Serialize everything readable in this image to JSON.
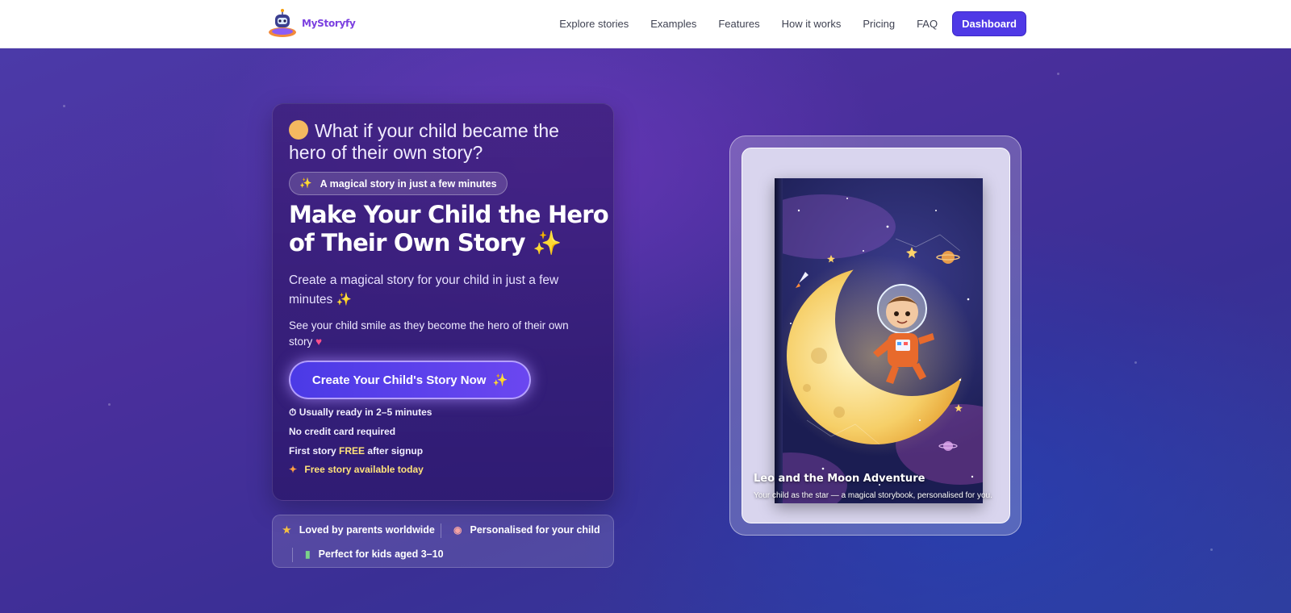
{
  "brand": {
    "name": "MyStoryfy"
  },
  "nav": {
    "links": [
      "Explore stories",
      "Examples",
      "Features",
      "How it works",
      "Pricing",
      "FAQ"
    ],
    "dashboard_label": "Dashboard"
  },
  "hero": {
    "question": "What if your child became the hero of their own story?",
    "pill": "A magical story in just a few minutes",
    "headline": "Make Your Child the Hero of Their Own Story",
    "subtitle": "Create a magical story for your child in just a few minutes",
    "subtitle2": "See your child smile as they become the hero of their own story",
    "cta_label": "Create Your Child's Story Now",
    "ready_note": "Usually ready in 2–5 minutes",
    "no_card": "No credit card required",
    "first_story_prefix": "First story",
    "first_story_free": "FREE",
    "first_story_suffix": "after signup",
    "free_today": "Free story available today"
  },
  "features": [
    {
      "icon": "star-icon",
      "label": "Loved by parents worldwide"
    },
    {
      "icon": "palette-icon",
      "label": "Personalised for your child"
    },
    {
      "icon": "books-icon",
      "label": "Perfect for kids aged 3–10"
    }
  ],
  "book": {
    "title": "Leo and the Moon Adventure",
    "caption": "Your child as the star — a magical storybook, personalised for you."
  },
  "colors": {
    "accent": "#4f39e6",
    "highlight": "#ffe27a"
  }
}
